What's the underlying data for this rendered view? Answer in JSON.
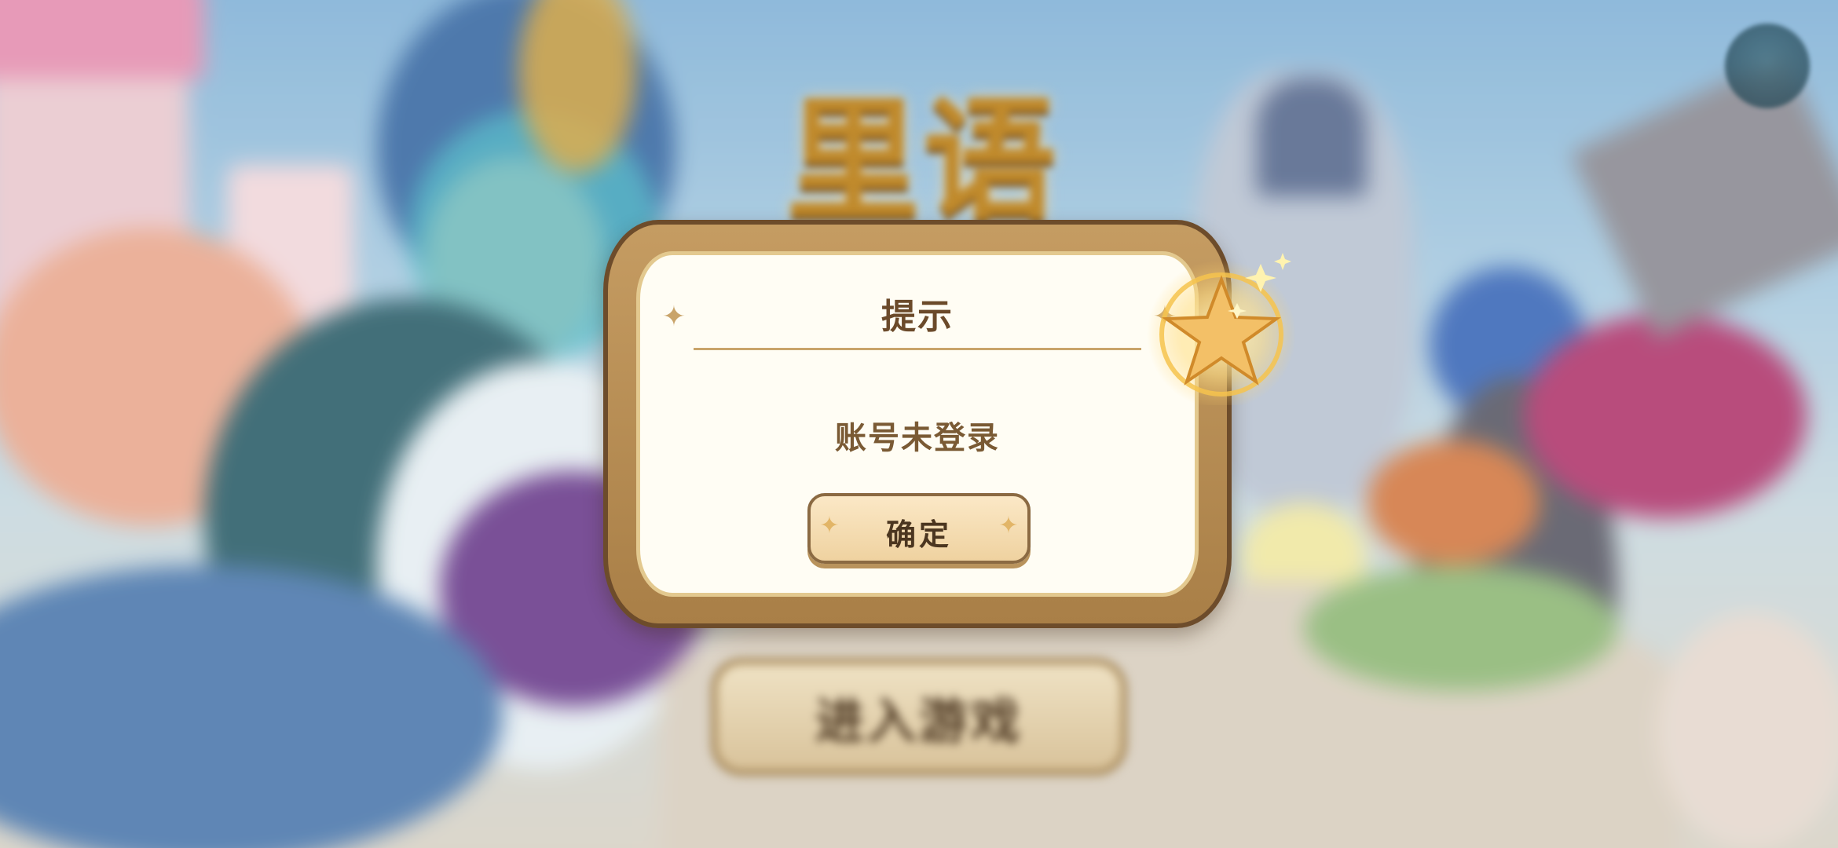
{
  "dialog": {
    "title": "提示",
    "message": "账号未登录",
    "confirm_label": "确定"
  },
  "background": {
    "logo_text": "里语",
    "enter_button_label": "进入游戏"
  },
  "colors": {
    "dialog_frame": "#a97f47",
    "dialog_panel": "#fffdf4",
    "title_text": "#6b4a2a",
    "message_text": "#7a5a34",
    "button_fill": "#f5dfb3",
    "accent_gold": "#c9a46a"
  },
  "icons": {
    "sparkle": "four-point-star",
    "ornament": "glowing-star",
    "corner_button": "round-menu-button"
  }
}
